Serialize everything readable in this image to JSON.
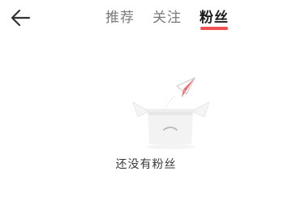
{
  "header": {
    "back_icon": "arrow-left-icon",
    "tabs": [
      {
        "label": "推荐",
        "active": false
      },
      {
        "label": "关注",
        "active": false
      },
      {
        "label": "粉丝",
        "active": true
      }
    ]
  },
  "empty_state": {
    "illustration": "empty-box-with-paper-plane-icon",
    "message": "还没有粉丝"
  },
  "colors": {
    "accent": "#f0504f",
    "text_active": "#1f1f1f",
    "text_inactive": "#7a7a7a",
    "background": "#ffffff"
  }
}
